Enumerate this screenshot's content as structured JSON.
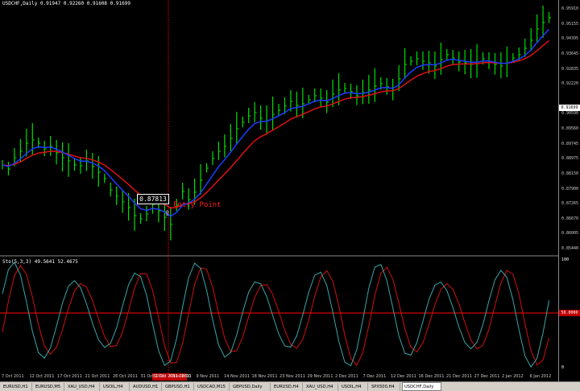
{
  "main_chart": {
    "title": "USDCHF,Daily  0.91947 0.92260 0.91608 0.91699",
    "price_levels": [
      "0.95910",
      "0.95155",
      "0.94395",
      "0.93645",
      "0.92835",
      "0.92220",
      "0.91699",
      "0.90590",
      "0.89560",
      "0.89745",
      "0.88975",
      "0.88150",
      "0.87900",
      "0.87265",
      "0.86670",
      "0.86005",
      "0.85440"
    ],
    "current_price": "0.91699",
    "annotation_text": "Entry Point",
    "crosshair_price": "0.87813",
    "colors": {
      "bars": "#00e000",
      "fast_ma": "#1c3cff",
      "slow_ma": "#e01010",
      "crosshair": "#c00000"
    }
  },
  "oscillator": {
    "title": "Sto(5,3,3) 49.5641 52.4675",
    "levels": [
      "100",
      "0"
    ],
    "level_tag": "50.0000",
    "colors": {
      "main": "#3aa6a6",
      "signal": "#d01010",
      "level": "#ff0000"
    }
  },
  "time_axis": {
    "dates": [
      "7 Oct 2011",
      "12 Oct 2011",
      "17 Oct 2011",
      "21 Oct 2011",
      "26 Oct 2011",
      "31 Oct 2011",
      "3 Nov 2011",
      "9 Nov 2011",
      "14 Nov 2011",
      "18 Nov 2011",
      "23 Nov 2011",
      "29 Nov 2011",
      "2 Dec 2011",
      "7 Dec 2011",
      "12 Dec 2011",
      "16 Dec 2011",
      "21 Dec 2011",
      "27 Dec 2011",
      "2 Jan 2012",
      "6 Jan 2012"
    ],
    "highlighted": "31 Oct 2011 00:00"
  },
  "tabs": [
    "EURUSD,H1",
    "EURUSD,M5",
    "XAU_USD,H4",
    "USOIL,H4",
    "AUDUSD,H1",
    "GBPUSD,H1",
    "USDCAD,M15",
    "GBPUSD,Daily",
    "EURUSD,H4",
    "XAU_USD,H4",
    "USOIL,H4",
    "SPX500,H4",
    "USDCHF,Daily"
  ],
  "active_tab": "USDCHF,Daily"
}
